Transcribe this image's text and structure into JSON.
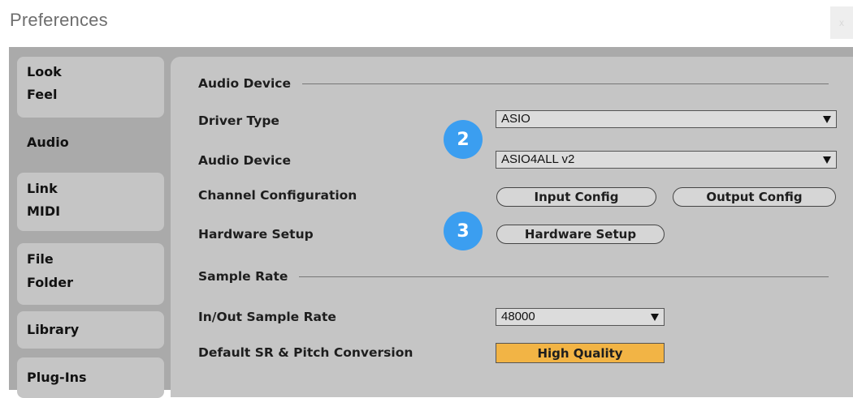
{
  "window": {
    "title": "Preferences",
    "close_label": "x"
  },
  "tabs": [
    {
      "lines": [
        "Look",
        "Feel"
      ]
    },
    {
      "lines": [
        "Audio"
      ]
    },
    {
      "lines": [
        "Link",
        "MIDI"
      ]
    },
    {
      "lines": [
        "File",
        "Folder"
      ]
    },
    {
      "lines": [
        "Library"
      ]
    },
    {
      "lines": [
        "Plug-Ins"
      ]
    }
  ],
  "audio_device": {
    "section_title": "Audio Device",
    "driver_type_label": "Driver Type",
    "driver_type_value": "ASIO",
    "audio_device_label": "Audio Device",
    "audio_device_value": "ASIO4ALL v2",
    "channel_config_label": "Channel Configuration",
    "input_config_label": "Input Config",
    "output_config_label": "Output Config",
    "hardware_setup_label": "Hardware Setup",
    "hardware_setup_button": "Hardware Setup"
  },
  "sample_rate": {
    "section_title": "Sample Rate",
    "in_out_label": "In/Out Sample Rate",
    "in_out_value": "48000",
    "conversion_label": "Default SR & Pitch Conversion",
    "conversion_value": "High Quality"
  },
  "badges": {
    "step2": "2",
    "step3": "3"
  },
  "colors": {
    "accent_badge": "#3b9ef0",
    "high_quality": "#f2b445",
    "panel": "#c5c5c5",
    "window": "#aaaaaa"
  }
}
